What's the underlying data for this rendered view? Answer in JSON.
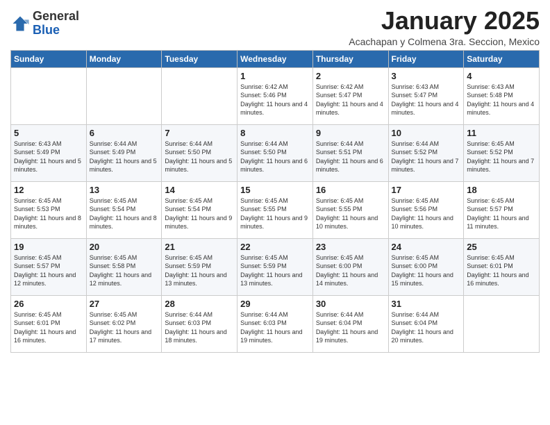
{
  "logo": {
    "general": "General",
    "blue": "Blue"
  },
  "title": "January 2025",
  "subtitle": "Acachapan y Colmena 3ra. Seccion, Mexico",
  "headers": [
    "Sunday",
    "Monday",
    "Tuesday",
    "Wednesday",
    "Thursday",
    "Friday",
    "Saturday"
  ],
  "weeks": [
    [
      {
        "day": "",
        "info": ""
      },
      {
        "day": "",
        "info": ""
      },
      {
        "day": "",
        "info": ""
      },
      {
        "day": "1",
        "info": "Sunrise: 6:42 AM\nSunset: 5:46 PM\nDaylight: 11 hours and 4 minutes."
      },
      {
        "day": "2",
        "info": "Sunrise: 6:42 AM\nSunset: 5:47 PM\nDaylight: 11 hours and 4 minutes."
      },
      {
        "day": "3",
        "info": "Sunrise: 6:43 AM\nSunset: 5:47 PM\nDaylight: 11 hours and 4 minutes."
      },
      {
        "day": "4",
        "info": "Sunrise: 6:43 AM\nSunset: 5:48 PM\nDaylight: 11 hours and 4 minutes."
      }
    ],
    [
      {
        "day": "5",
        "info": "Sunrise: 6:43 AM\nSunset: 5:49 PM\nDaylight: 11 hours and 5 minutes."
      },
      {
        "day": "6",
        "info": "Sunrise: 6:44 AM\nSunset: 5:49 PM\nDaylight: 11 hours and 5 minutes."
      },
      {
        "day": "7",
        "info": "Sunrise: 6:44 AM\nSunset: 5:50 PM\nDaylight: 11 hours and 5 minutes."
      },
      {
        "day": "8",
        "info": "Sunrise: 6:44 AM\nSunset: 5:50 PM\nDaylight: 11 hours and 6 minutes."
      },
      {
        "day": "9",
        "info": "Sunrise: 6:44 AM\nSunset: 5:51 PM\nDaylight: 11 hours and 6 minutes."
      },
      {
        "day": "10",
        "info": "Sunrise: 6:44 AM\nSunset: 5:52 PM\nDaylight: 11 hours and 7 minutes."
      },
      {
        "day": "11",
        "info": "Sunrise: 6:45 AM\nSunset: 5:52 PM\nDaylight: 11 hours and 7 minutes."
      }
    ],
    [
      {
        "day": "12",
        "info": "Sunrise: 6:45 AM\nSunset: 5:53 PM\nDaylight: 11 hours and 8 minutes."
      },
      {
        "day": "13",
        "info": "Sunrise: 6:45 AM\nSunset: 5:54 PM\nDaylight: 11 hours and 8 minutes."
      },
      {
        "day": "14",
        "info": "Sunrise: 6:45 AM\nSunset: 5:54 PM\nDaylight: 11 hours and 9 minutes."
      },
      {
        "day": "15",
        "info": "Sunrise: 6:45 AM\nSunset: 5:55 PM\nDaylight: 11 hours and 9 minutes."
      },
      {
        "day": "16",
        "info": "Sunrise: 6:45 AM\nSunset: 5:55 PM\nDaylight: 11 hours and 10 minutes."
      },
      {
        "day": "17",
        "info": "Sunrise: 6:45 AM\nSunset: 5:56 PM\nDaylight: 11 hours and 10 minutes."
      },
      {
        "day": "18",
        "info": "Sunrise: 6:45 AM\nSunset: 5:57 PM\nDaylight: 11 hours and 11 minutes."
      }
    ],
    [
      {
        "day": "19",
        "info": "Sunrise: 6:45 AM\nSunset: 5:57 PM\nDaylight: 11 hours and 12 minutes."
      },
      {
        "day": "20",
        "info": "Sunrise: 6:45 AM\nSunset: 5:58 PM\nDaylight: 11 hours and 12 minutes."
      },
      {
        "day": "21",
        "info": "Sunrise: 6:45 AM\nSunset: 5:59 PM\nDaylight: 11 hours and 13 minutes."
      },
      {
        "day": "22",
        "info": "Sunrise: 6:45 AM\nSunset: 5:59 PM\nDaylight: 11 hours and 13 minutes."
      },
      {
        "day": "23",
        "info": "Sunrise: 6:45 AM\nSunset: 6:00 PM\nDaylight: 11 hours and 14 minutes."
      },
      {
        "day": "24",
        "info": "Sunrise: 6:45 AM\nSunset: 6:00 PM\nDaylight: 11 hours and 15 minutes."
      },
      {
        "day": "25",
        "info": "Sunrise: 6:45 AM\nSunset: 6:01 PM\nDaylight: 11 hours and 16 minutes."
      }
    ],
    [
      {
        "day": "26",
        "info": "Sunrise: 6:45 AM\nSunset: 6:01 PM\nDaylight: 11 hours and 16 minutes."
      },
      {
        "day": "27",
        "info": "Sunrise: 6:45 AM\nSunset: 6:02 PM\nDaylight: 11 hours and 17 minutes."
      },
      {
        "day": "28",
        "info": "Sunrise: 6:44 AM\nSunset: 6:03 PM\nDaylight: 11 hours and 18 minutes."
      },
      {
        "day": "29",
        "info": "Sunrise: 6:44 AM\nSunset: 6:03 PM\nDaylight: 11 hours and 19 minutes."
      },
      {
        "day": "30",
        "info": "Sunrise: 6:44 AM\nSunset: 6:04 PM\nDaylight: 11 hours and 19 minutes."
      },
      {
        "day": "31",
        "info": "Sunrise: 6:44 AM\nSunset: 6:04 PM\nDaylight: 11 hours and 20 minutes."
      },
      {
        "day": "",
        "info": ""
      }
    ]
  ]
}
